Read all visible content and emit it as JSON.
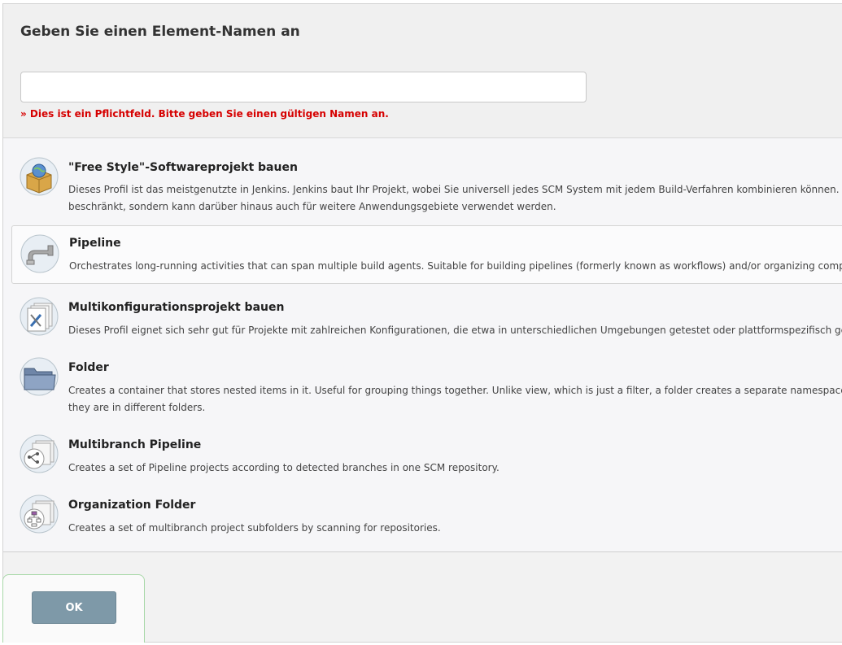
{
  "form": {
    "heading": "Geben Sie einen Element-Namen an",
    "name_value": "",
    "error": "» Dies ist ein Pflichtfeld. Bitte geben Sie einen gültigen Namen an."
  },
  "items": [
    {
      "label": "\"Free Style\"-Softwareprojekt bauen",
      "desc1": "Dieses Profil ist das meistgenutzte in Jenkins. Jenkins baut Ihr Projekt, wobei Sie universell jedes SCM System mit jedem Build-Verfahren kombinieren können. D",
      "desc2": "beschränkt, sondern kann darüber hinaus auch für weitere Anwendungsgebiete verwendet werden.",
      "icon": "freestyle-project-icon"
    },
    {
      "label": "Pipeline",
      "desc1": "Orchestrates long-running activities that can span multiple build agents. Suitable for building pipelines (formerly known as workflows) and/or organizing comp",
      "desc2": "",
      "icon": "pipeline-icon"
    },
    {
      "label": "Multikonfigurationsprojekt bauen",
      "desc1": "Dieses Profil eignet sich sehr gut für Projekte mit zahlreichen Konfigurationen, die etwa in unterschiedlichen Umgebungen getestet oder plattformspezifisch ge",
      "desc2": "",
      "icon": "multi-configuration-icon"
    },
    {
      "label": "Folder",
      "desc1": "Creates a container that stores nested items in it. Useful for grouping things together. Unlike view, which is just a filter, a folder creates a separate namespace, s",
      "desc2": "they are in different folders.",
      "icon": "folder-icon"
    },
    {
      "label": "Multibranch Pipeline",
      "desc1": "Creates a set of Pipeline projects according to detected branches in one SCM repository.",
      "desc2": "",
      "icon": "multibranch-pipeline-icon"
    },
    {
      "label": "Organization Folder",
      "desc1": "Creates a set of multibranch project subfolders by scanning for repositories.",
      "desc2": "",
      "icon": "organization-folder-icon"
    }
  ],
  "footer": {
    "ok_label": "OK"
  }
}
